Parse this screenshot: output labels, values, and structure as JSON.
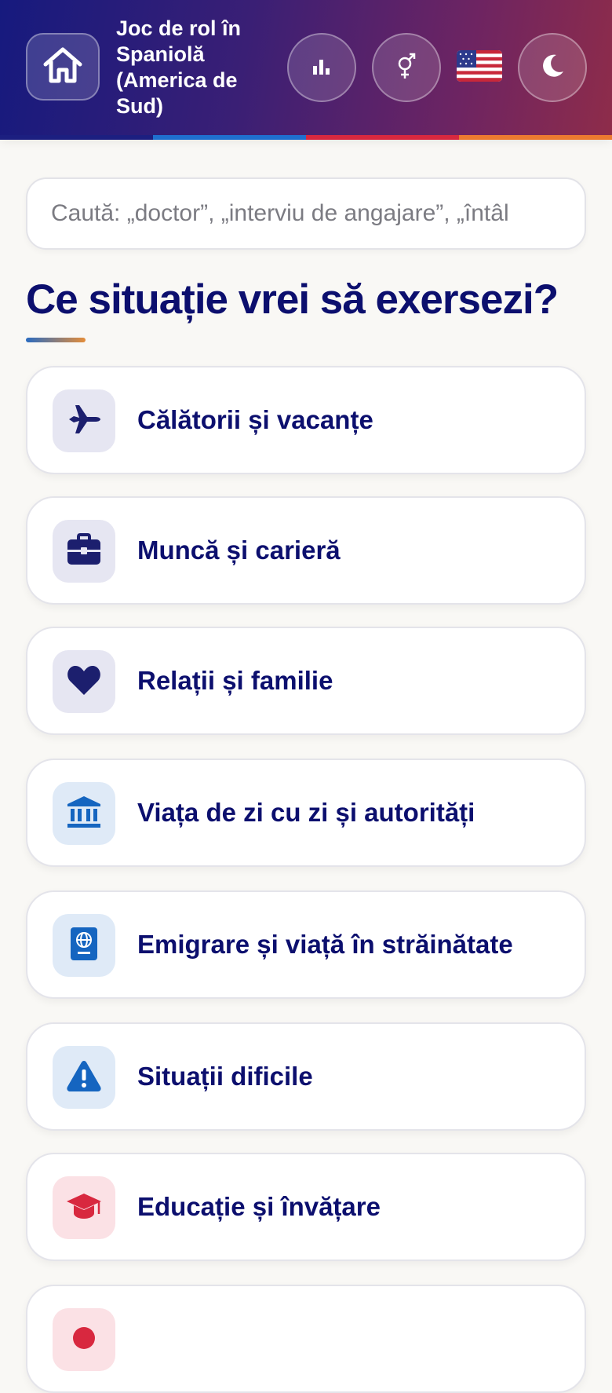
{
  "header": {
    "title": "Joc de rol în Spaniolă (America de Sud)",
    "icons": {
      "home": "home-icon",
      "stats": "bar-chart-icon",
      "gender": "gender-icon",
      "flag": "us-flag-icon",
      "theme": "moon-icon"
    },
    "stripe_colors": [
      "#1c1f80",
      "#1f6fcf",
      "#d8283f",
      "#ec7a30"
    ]
  },
  "search": {
    "placeholder": "Caută: „doctor”, „interviu de angajare”, „întâl"
  },
  "heading": "Ce situație vrei să exersezi?",
  "categories": [
    {
      "label": "Călătorii și vacanțe",
      "icon": "airplane-icon",
      "tint": "#e6e6f2",
      "color": "#1c1f6e"
    },
    {
      "label": "Muncă și carieră",
      "icon": "briefcase-icon",
      "tint": "#e6e6f2",
      "color": "#1c1f6e"
    },
    {
      "label": "Relații și familie",
      "icon": "heart-icon",
      "tint": "#e6e6f2",
      "color": "#1c1f6e"
    },
    {
      "label": "Viața de zi cu zi și autorități",
      "icon": "bank-icon",
      "tint": "#dfeaf7",
      "color": "#1565c0"
    },
    {
      "label": "Emigrare și viață în străinătate",
      "icon": "passport-icon",
      "tint": "#dfeaf7",
      "color": "#1565c0"
    },
    {
      "label": "Situații dificile",
      "icon": "warning-icon",
      "tint": "#dfeaf7",
      "color": "#1565c0"
    },
    {
      "label": "Educație și învățare",
      "icon": "graduation-cap-icon",
      "tint": "#fbe1e5",
      "color": "#d8283f"
    },
    {
      "label": "",
      "icon": "category-icon",
      "tint": "#fbe1e5",
      "color": "#d8283f"
    }
  ]
}
